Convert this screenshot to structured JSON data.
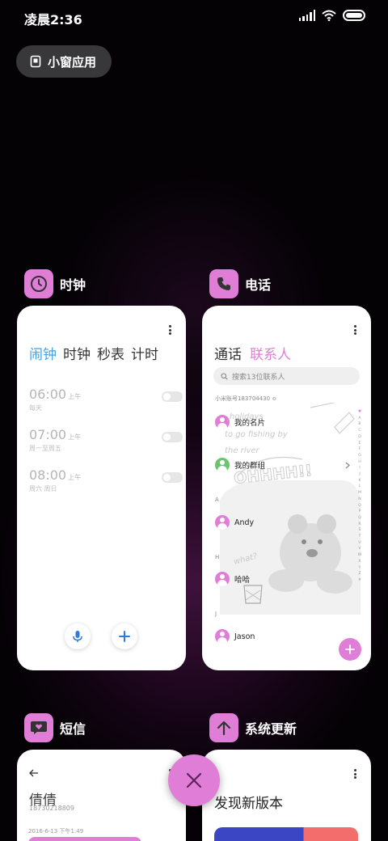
{
  "status_bar": {
    "time": "凌晨2:36"
  },
  "floating_window_button": {
    "label": "小窗应用"
  },
  "apps": {
    "clock": {
      "name": "时钟",
      "tabs": [
        "闹钟",
        "时钟",
        "秒表",
        "计时"
      ],
      "active_tab": "闹钟",
      "alarms": [
        {
          "time": "06:00",
          "ampm": "上午",
          "days": "每天"
        },
        {
          "time": "07:00",
          "ampm": "上午",
          "days": "周一至周五"
        },
        {
          "time": "08:00",
          "ampm": "上午",
          "days": "周六 周日"
        }
      ]
    },
    "phone": {
      "name": "电话",
      "tabs": [
        "通话",
        "联系人"
      ],
      "active_tab": "联系人",
      "search_placeholder": "搜索13位联系人",
      "account": "小米账号183704430",
      "my_card": "我的名片",
      "my_groups": "我的群组",
      "sections": [
        {
          "letter": "A",
          "contacts": [
            "Andy"
          ]
        },
        {
          "letter": "H",
          "contacts": [
            "哈哈"
          ]
        },
        {
          "letter": "J",
          "contacts": [
            "Jason"
          ]
        }
      ],
      "index_letters": [
        "♥",
        "A",
        "B",
        "C",
        "D",
        "E",
        "F",
        "G",
        "H",
        "I",
        "J",
        "K",
        "L",
        "M",
        "N",
        "O",
        "P",
        "Q",
        "R",
        "S",
        "T",
        "U",
        "V",
        "W",
        "X",
        "Y",
        "Z",
        "#"
      ]
    },
    "sms": {
      "name": "短信",
      "contact_name": "倩倩",
      "contact_number": "18730218809",
      "date": "2016-6-13 下午1:49"
    },
    "update": {
      "name": "系统更新",
      "title": "发现新版本"
    }
  },
  "colors": {
    "accent": "#e07ed7",
    "clock_active_tab": "#3ea4e4",
    "background": "#050206"
  },
  "icons": {
    "floating_window": "floating-window-icon",
    "clock": "clock-icon",
    "phone": "phone-handset-icon",
    "sms": "message-heart-icon",
    "update": "arrow-up-icon",
    "close": "close-icon"
  }
}
